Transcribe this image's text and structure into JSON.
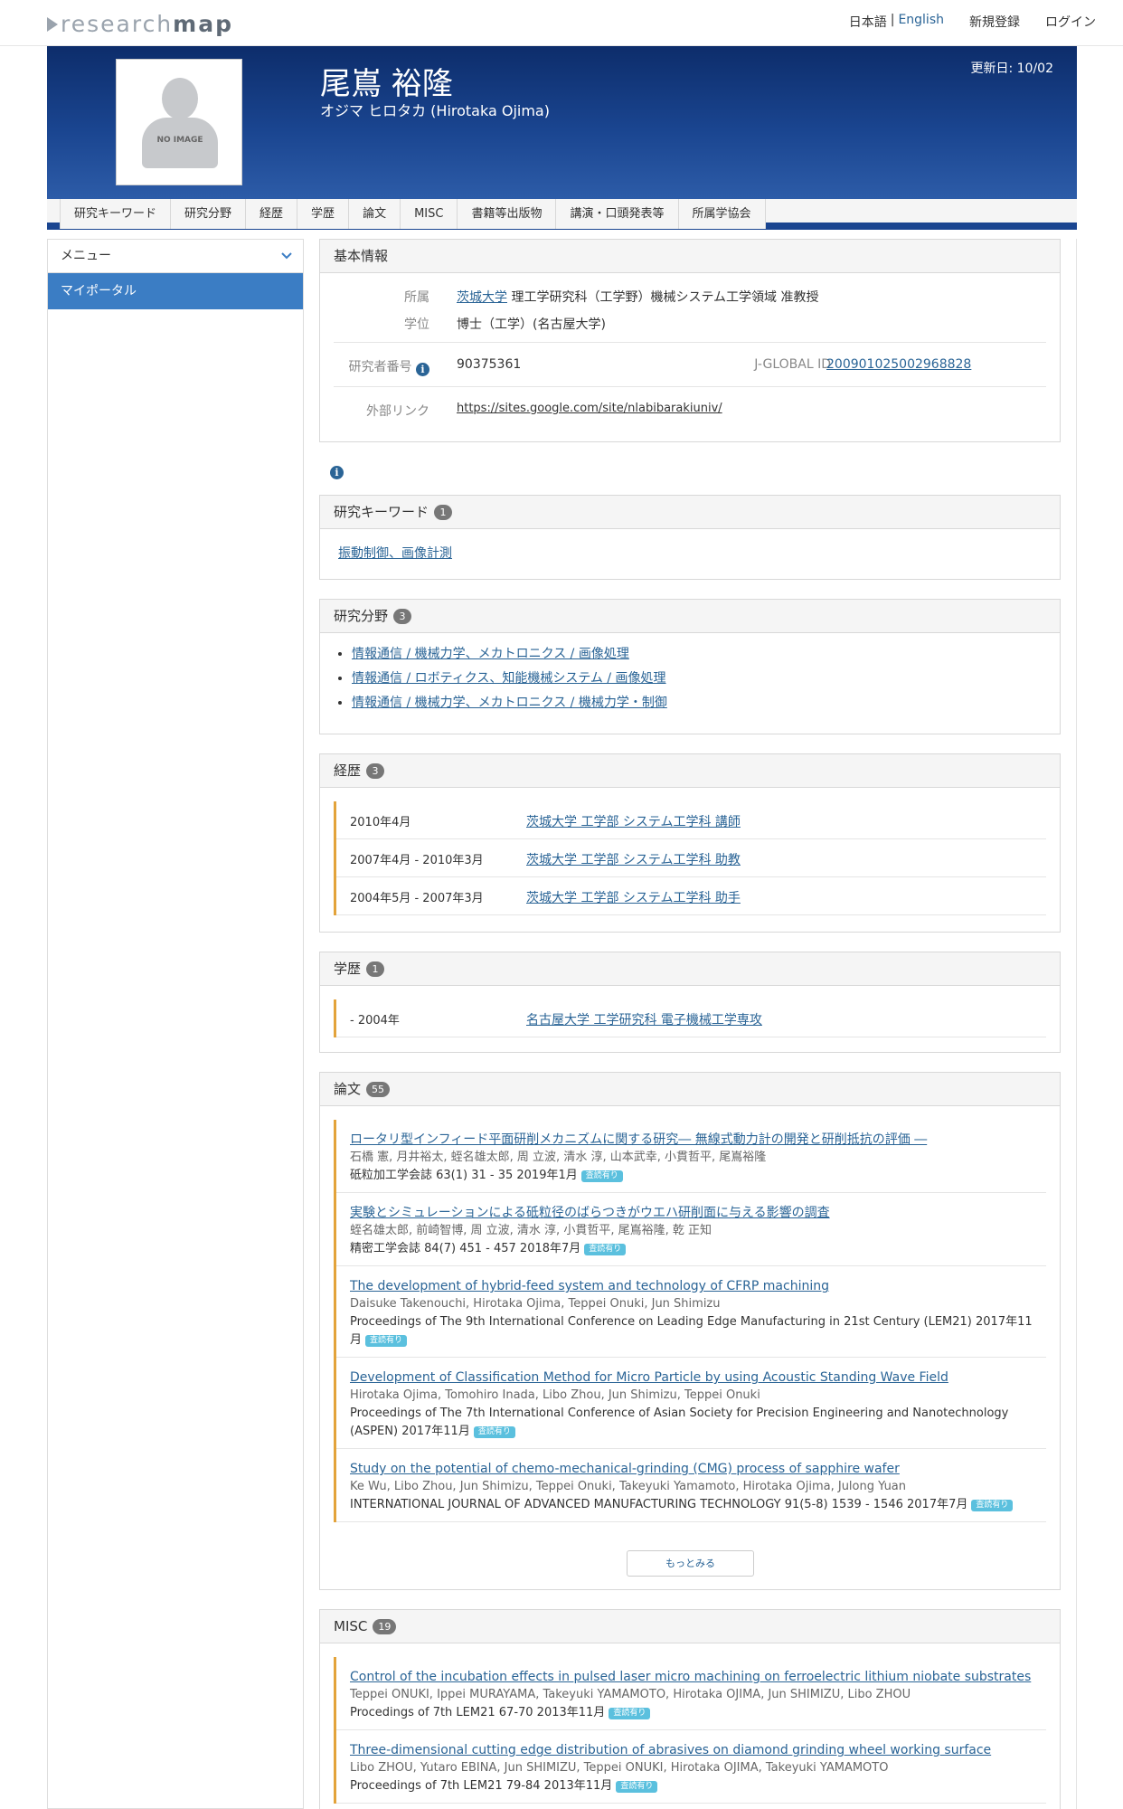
{
  "topbar": {
    "logo_light": "research",
    "logo_bold": "map",
    "lang_ja": "日本語",
    "lang_sep": "|",
    "lang_en": "English",
    "register": "新規登録",
    "login": "ログイン"
  },
  "profile": {
    "name": "尾嶌 裕隆",
    "kana": "オジマ ヒロタカ  (Hirotaka Ojima)",
    "updated": "更新日: 10/02",
    "noimage": "NO IMAGE"
  },
  "tabs": [
    "研究キーワード",
    "研究分野",
    "経歴",
    "学歴",
    "論文",
    "MISC",
    "書籍等出版物",
    "講演・口頭発表等",
    "所属学協会"
  ],
  "sidebar": {
    "menu_label": "メニュー",
    "portal_label": "マイポータル"
  },
  "basic": {
    "title": "基本情報",
    "affiliation_label": "所属",
    "affiliation_link": "茨城大学",
    "affiliation_rest": " 理工学研究科（工学野）機械システム工学領域 准教授",
    "degree_label": "学位",
    "degree_value": "博士（工学）(名古屋大学)",
    "researcher_no_label": "研究者番号",
    "researcher_no_value": "90375361",
    "jglobal_label": "J-GLOBAL ID",
    "jglobal_value": "200901025002968828",
    "external_label": "外部リンク",
    "external_value": "https://sites.google.com/site/nlabibarakiuniv/"
  },
  "keywords": {
    "title": "研究キーワード",
    "count": "1",
    "items": [
      "振動制御、画像計測"
    ]
  },
  "fields": {
    "title": "研究分野",
    "count": "3",
    "items": [
      "情報通信 / 機械力学、メカトロニクス / 画像処理",
      "情報通信 / ロボティクス、知能機械システム / 画像処理",
      "情報通信 / 機械力学、メカトロニクス / 機械力学・制御"
    ]
  },
  "career": {
    "title": "経歴",
    "count": "3",
    "items": [
      {
        "date": "2010年4月",
        "text": "茨城大学 工学部 システム工学科 講師"
      },
      {
        "date": "2007年4月 - 2010年3月",
        "text": "茨城大学 工学部 システム工学科 助教"
      },
      {
        "date": "2004年5月 - 2007年3月",
        "text": "茨城大学 工学部 システム工学科 助手"
      }
    ]
  },
  "education": {
    "title": "学歴",
    "count": "1",
    "items": [
      {
        "date": "- 2004年",
        "text": "名古屋大学 工学研究科 電子機械工学専攻"
      }
    ]
  },
  "papers": {
    "title": "論文",
    "count": "55",
    "more": "もっとみる",
    "peer": "査読有り",
    "items": [
      {
        "title": "ロータリ型インフィード平面研削メカニズムに関する研究― 無線式動力計の開発と研削抵抗の評価 ―",
        "authors": "石橋 憲, 月井裕太, 蛭名雄太郎, 周 立波, 清水 淳, 山本武幸, 小貫哲平, 尾嶌裕隆",
        "source": "砥粒加工学会誌 63(1) 31 - 35 2019年1月"
      },
      {
        "title": "実験とシミュレーションによる砥粒径のばらつきがウエハ研削面に与える影響の調査",
        "authors": "蛭名雄太郎, 前崎智博, 周 立波, 清水 淳, 小貫哲平, 尾嶌裕隆, 乾 正知",
        "source": "精密工学会誌 84(7) 451 - 457 2018年7月"
      },
      {
        "title": "The development of hybrid-feed system and technology of CFRP machining",
        "authors": "Daisuke Takenouchi, Hirotaka Ojima, Teppei Onuki, Jun Shimizu",
        "source": "Proceedings of The 9th International Conference on Leading Edge Manufacturing in 21st Century (LEM21) 2017年11月"
      },
      {
        "title": "Development of Classification Method for Micro Particle by using Acoustic Standing Wave Field",
        "authors": "Hirotaka Ojima, Tomohiro Inada, Libo Zhou, Jun Shimizu, Teppei Onuki",
        "source": "Proceedings of The 7th International Conference of Asian Society for Precision Engineering and Nanotechnology (ASPEN) 2017年11月"
      },
      {
        "title": "Study on the potential of chemo-mechanical-grinding (CMG) process of sapphire wafer",
        "authors": "Ke Wu, Libo Zhou, Jun Shimizu, Teppei Onuki, Takeyuki Yamamoto, Hirotaka Ojima, Julong Yuan",
        "source": "INTERNATIONAL JOURNAL OF ADVANCED MANUFACTURING TECHNOLOGY 91(5-8) 1539 - 1546 2017年7月"
      }
    ]
  },
  "misc": {
    "title": "MISC",
    "count": "19",
    "peer": "査読有り",
    "items": [
      {
        "title": "Control of the incubation effects in pulsed laser micro machining on ferroelectric lithium niobate substrates",
        "authors": "Teppei ONUKI, Ippei MURAYAMA, Takeyuki YAMAMOTO, Hirotaka OJIMA, Jun SHIMIZU, Libo ZHOU",
        "source": "Procedings of 7th LEM21 67-70 2013年11月"
      },
      {
        "title": "Three-dimensional cutting edge distribution of abrasives on diamond grinding wheel working surface",
        "authors": "Libo ZHOU, Yutaro EBINA, Jun SHIMIZU, Teppei ONUKI, Hirotaka OJIMA, Takeyuki YAMAMOTO",
        "source": "Proceedings of 7th LEM21 79-84 2013年11月"
      }
    ]
  },
  "colors": {
    "banner": "#1a4590",
    "accent_link": "#2a6496",
    "portal_bg": "#3b7dc4",
    "entry_border": "#e3a33b",
    "peer_badge": "#5bc0de"
  }
}
